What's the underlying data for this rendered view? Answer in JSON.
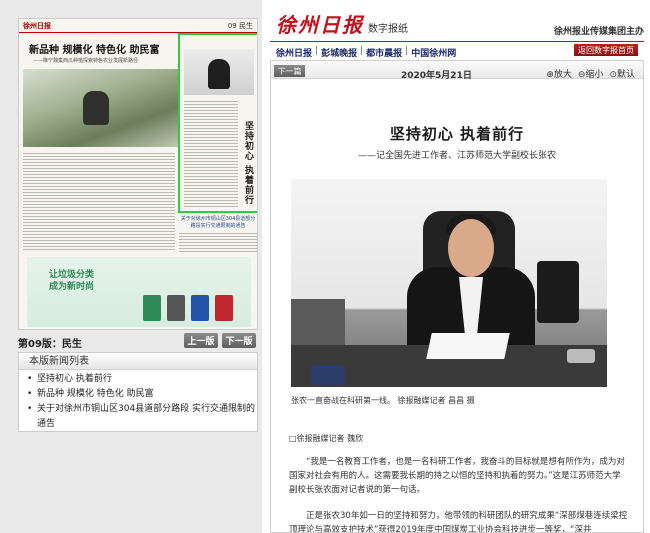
{
  "newspaper": {
    "page_number": "09",
    "page_section": "民生",
    "head1": "新品种 规模化 特色化 助民富",
    "head1_sub": "——睢宁魏集西瓜种植探索特色农业发展新路径",
    "vertical_title": "坚持初心 执着前行",
    "blue_head": "关于对徐州市铜山区304县道部分路段实行交通限制的通告",
    "ad_text_line1": "让垃圾分类",
    "ad_text_line2": "成为新时尚"
  },
  "page_nav": {
    "label": "第09版：民生",
    "prev": "上一版",
    "next": "下一版"
  },
  "news_list": {
    "title": "本版新闻列表",
    "items": [
      "坚持初心 执着前行",
      "新品种 规模化 特色化 助民富",
      "关于对徐州市铜山区304县道部分路段 实行交通限制的通告"
    ]
  },
  "header": {
    "logo": "徐州日报",
    "logo_sub": "数字报纸",
    "group": "徐州报业传媒集团主办",
    "links": [
      "徐州日报",
      "彭城晚报",
      "都市晨报",
      "中国徐州网"
    ],
    "home_button": "返回数字报首页"
  },
  "toolbar": {
    "next_article": "下一篇",
    "date": "2020年5月21日",
    "zoom_in": "放大",
    "zoom_out": "缩小",
    "default": "默认"
  },
  "article": {
    "title": "坚持初心 执着前行",
    "subtitle": "——记全国先进工作者、江苏师范大学副校长张农",
    "photo_caption": "张农一直奋战在科研第一线。  徐报融媒记者 昌昌 摄",
    "author": "□徐报融媒记者 魏欣",
    "para1": "“我是一名教育工作者，也是一名科研工作者，我奋斗的目标就是想有所作为，成为对国家对社会有用的人。这需要我长期的持之以恒的坚持和执着的努力。”这是江苏师范大学副校长张农面对记者说的第一句话。",
    "para2": "正是张农30年如一日的坚持和努力，他带领的科研团队的研究成果“深部煤巷连续梁控顶理论与高效支护技术”获得2019年度中国煤炭工业协会科技进步一等奖，“深井"
  },
  "colors": {
    "brand_red": "#c0101b",
    "highlight_green": "#2ecc40",
    "nav_blue": "#1a2a6e"
  }
}
